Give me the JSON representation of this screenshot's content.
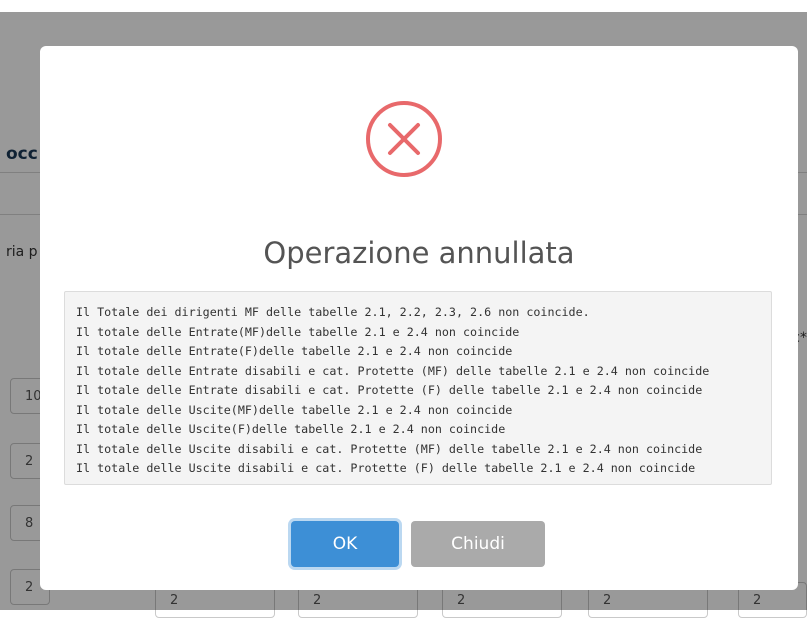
{
  "background": {
    "title_fragment": "occ",
    "text_fragment": "ria p",
    "right_fragment": "c*",
    "cells": [
      "10",
      "2",
      "8",
      "2"
    ],
    "bottom_cells": [
      "2",
      "2",
      "2",
      "2",
      "2"
    ]
  },
  "modal": {
    "icon": "error-circle-x-icon",
    "title": "Operazione annullata",
    "messages": [
      "Il Totale dei dirigenti MF delle tabelle 2.1, 2.2, 2.3, 2.6 non coincide.",
      "Il totale delle Entrate(MF)delle tabelle 2.1 e 2.4 non coincide",
      "Il totale delle Entrate(F)delle tabelle 2.1 e 2.4 non coincide",
      "Il totale delle Entrate disabili e cat. Protette (MF) delle tabelle 2.1 e 2.4 non coincide",
      "Il totale delle Entrate disabili e cat. Protette (F) delle tabelle 2.1 e 2.4 non coincide",
      "Il totale delle Uscite(MF)delle tabelle 2.1 e 2.4 non coincide",
      "Il totale delle Uscite(F)delle tabelle 2.1 e 2.4 non coincide",
      "Il totale delle Uscite disabili e cat. Protette (MF) delle tabelle 2.1 e 2.4 non coincide",
      "Il totale delle Uscite disabili e cat. Protette (F) delle tabelle 2.1 e 2.4 non coincide"
    ],
    "ok_label": "OK",
    "close_label": "Chiudi"
  },
  "colors": {
    "error_accent": "#e8696b",
    "ok_button": "#3d8fd6",
    "close_button": "#aaaaaa",
    "title_text": "#545454"
  }
}
